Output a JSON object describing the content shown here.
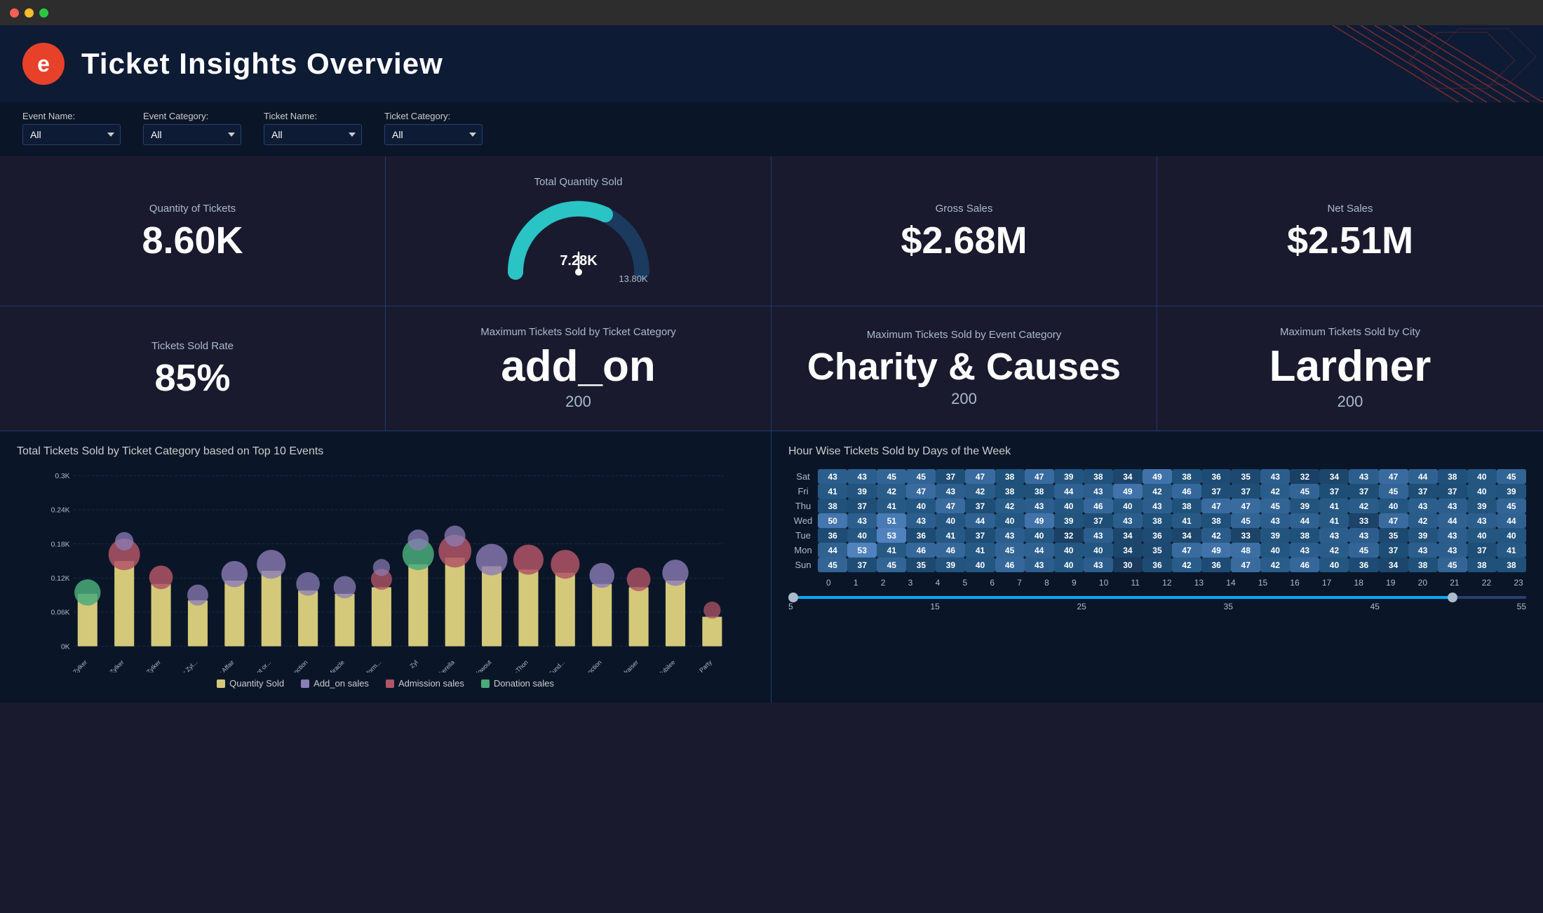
{
  "window": {
    "dots": [
      "red",
      "yellow",
      "green"
    ]
  },
  "header": {
    "logo_text": "e",
    "title": "Ticket Insights Overview"
  },
  "filters": [
    {
      "label": "Event Name:",
      "value": "All",
      "options": [
        "All"
      ]
    },
    {
      "label": "Event Category:",
      "value": "All",
      "options": [
        "All"
      ]
    },
    {
      "label": "Ticket Name:",
      "value": "All",
      "options": [
        "All"
      ]
    },
    {
      "label": "Ticket Category:",
      "value": "All",
      "options": [
        "All"
      ]
    }
  ],
  "kpi_row1": [
    {
      "label": "Quantity of Tickets",
      "value": "8.60K",
      "sub": ""
    },
    {
      "label": "Total Quantity Sold",
      "value": "7.28K",
      "sub": "13.80K",
      "type": "gauge"
    },
    {
      "label": "Gross Sales",
      "value": "$2.68M",
      "sub": ""
    },
    {
      "label": "Net Sales",
      "value": "$2.51M",
      "sub": ""
    }
  ],
  "kpi_row2": [
    {
      "label": "Tickets Sold Rate",
      "value": "85%",
      "sub": ""
    },
    {
      "label": "Maximum Tickets Sold by Ticket Category",
      "value": "add_on",
      "sub": "200"
    },
    {
      "label": "Maximum Tickets Sold by Event Category",
      "value": "Charity & Causes",
      "sub": "200"
    },
    {
      "label": "Maximum Tickets Sold by City",
      "value": "Lardner",
      "sub": "200"
    }
  ],
  "bar_chart": {
    "title": "Total Tickets Sold by Ticket Category based on Top 10 Events",
    "y_labels": [
      "0K",
      "0.06K",
      "0.12K",
      "0.18K",
      "0.24K",
      "0.3K"
    ],
    "legend": [
      {
        "label": "Quantity Sold",
        "color": "#d4c97a"
      },
      {
        "label": "Add_on sales",
        "color": "#8b7db5"
      },
      {
        "label": "Admission sales",
        "color": "#b05565"
      },
      {
        "label": "Donation sales",
        "color": "#4aaa7a"
      }
    ],
    "events": [
      "A Spree of Zylker",
      "A Triumph of Zylker",
      "An Evening of Zylker",
      "An Occasion for Zyl...",
      "A Zylker Affair",
      "The Zylker Event or...",
      "The Zylker Function",
      "The Zylker Miracle",
      "The Zylker Perform...",
      "Zyl",
      "Zyikerella",
      "Zylker Blowout",
      "Zylker Bowl-A-Thon",
      "Zylker Charity Fund...",
      "Zylker Function",
      "Zylker Fundraiser",
      "Zylker Jubilee",
      "Zylker Party"
    ]
  },
  "heatmap": {
    "title": "Hour Wise Tickets Sold by Days of the Week",
    "rows": [
      {
        "day": "Sat",
        "values": [
          43,
          43,
          45,
          45,
          37,
          47,
          38,
          47,
          39,
          38,
          34,
          49,
          38,
          36,
          35,
          43,
          32,
          34,
          43,
          47,
          44,
          38,
          40,
          45
        ]
      },
      {
        "day": "Fri",
        "values": [
          41,
          39,
          42,
          47,
          43,
          42,
          38,
          38,
          44,
          43,
          49,
          42,
          46,
          37,
          37,
          42,
          45,
          37,
          37,
          45,
          37,
          37,
          40,
          39
        ]
      },
      {
        "day": "Thu",
        "values": [
          38,
          37,
          41,
          40,
          47,
          37,
          42,
          43,
          40,
          46,
          40,
          43,
          38,
          47,
          47,
          45,
          39,
          41,
          42,
          40,
          43,
          43,
          39,
          45
        ]
      },
      {
        "day": "Wed",
        "values": [
          50,
          43,
          51,
          43,
          40,
          44,
          40,
          49,
          39,
          37,
          43,
          38,
          41,
          38,
          45,
          43,
          44,
          41,
          33,
          47,
          42,
          44,
          43,
          44
        ]
      },
      {
        "day": "Tue",
        "values": [
          36,
          40,
          53,
          36,
          41,
          37,
          43,
          40,
          32,
          43,
          34,
          36,
          34,
          42,
          33,
          39,
          38,
          43,
          43,
          35,
          39,
          43,
          40,
          40
        ]
      },
      {
        "day": "Mon",
        "values": [
          44,
          53,
          41,
          46,
          46,
          41,
          45,
          44,
          40,
          40,
          34,
          35,
          47,
          49,
          48,
          40,
          43,
          42,
          45,
          37,
          43,
          43,
          37,
          41
        ]
      },
      {
        "day": "Sun",
        "values": [
          45,
          37,
          45,
          35,
          39,
          40,
          46,
          43,
          40,
          43,
          30,
          36,
          42,
          36,
          47,
          42,
          46,
          40,
          36,
          34,
          38,
          45,
          38,
          38
        ]
      }
    ],
    "col_labels": [
      0,
      1,
      2,
      3,
      4,
      5,
      6,
      7,
      8,
      9,
      10,
      11,
      12,
      13,
      14,
      15,
      16,
      17,
      18,
      19,
      20,
      21,
      22,
      23
    ],
    "slider": {
      "min": 5,
      "max": 55,
      "labels": [
        5,
        15,
        25,
        35,
        45,
        55
      ]
    }
  },
  "colors": {
    "background": "#0a1628",
    "header_bg": "#0d1b35",
    "border": "#1e3a6e",
    "accent": "#e8412a",
    "gauge_teal": "#2ac4c4",
    "gauge_dark": "#1a3a5e",
    "bar_qty": "#d4c97a",
    "bar_addon": "#8b7db5",
    "bar_admission": "#b05565",
    "bar_donation": "#4aaa7a",
    "heatmap_low": "#1a3a5e",
    "heatmap_mid": "#2a5a8e",
    "heatmap_high": "#3a7abe"
  }
}
